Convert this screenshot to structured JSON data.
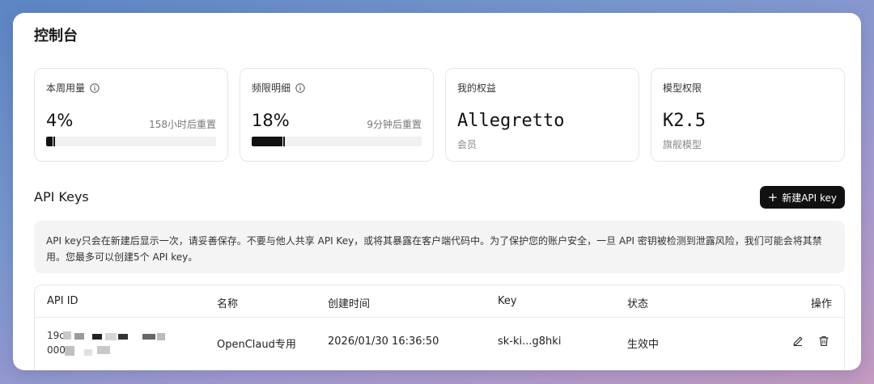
{
  "page": {
    "title": "控制台"
  },
  "cards": {
    "weekly": {
      "label": "本周用量",
      "percent": "4%",
      "reset": "158小时后重置",
      "fill": 0.04
    },
    "rate": {
      "label": "频限明细",
      "percent": "18%",
      "reset": "9分钟后重置",
      "fill": 0.18
    },
    "benefit": {
      "label": "我的权益",
      "value": "Allegretto",
      "sub": "会员"
    },
    "model": {
      "label": "模型权限",
      "value": "K2.5",
      "sub": "旗舰模型"
    }
  },
  "api_keys": {
    "title": "API Keys",
    "new_button": "新建API key",
    "notice": "API key只会在新建后显示一次，请妥善保存。不要与他人共享 API Key，或将其暴露在客户端代码中。为了保护您的账户安全，一旦 API 密钥被检测到泄露风险，我们可能会将其禁用。您最多可以创建5个 API key。",
    "columns": [
      "API ID",
      "名称",
      "创建时间",
      "Key",
      "状态",
      "操作"
    ],
    "rows": [
      {
        "id_line1": "19c",
        "id_line2": "000",
        "name": "OpenClaud专用",
        "created": "2026/01/30 16:36:50",
        "key": "sk-ki...g8hki",
        "status": "生效中"
      }
    ]
  },
  "icons": {
    "info": "info-icon",
    "plus": "plus-icon",
    "edit": "edit-icon",
    "delete": "trash-icon"
  },
  "colors": {
    "accent": "#111111",
    "track": "#f1f1f1"
  }
}
